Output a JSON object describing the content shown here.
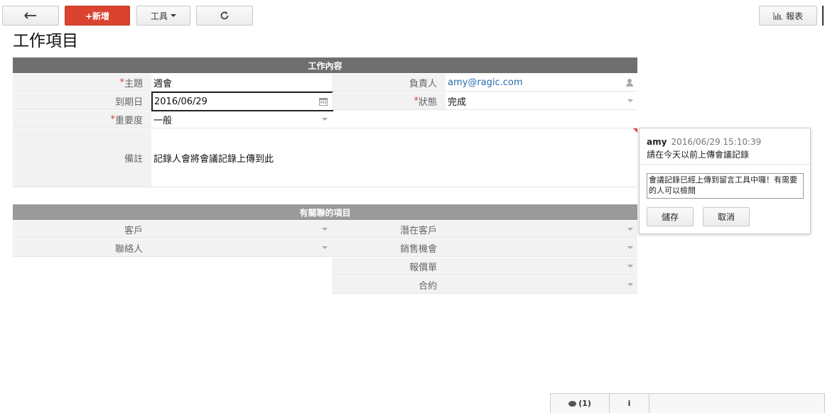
{
  "toolbar": {
    "back_icon": "arrow-left-icon",
    "new_label": "+新增",
    "tools_label": "工具",
    "refresh_icon": "refresh-icon",
    "report_label": "報表",
    "report_icon": "bar-chart-icon"
  },
  "page": {
    "title": "工作項目"
  },
  "section_main": {
    "title": "工作內容",
    "fields": {
      "subject": {
        "label": "主題",
        "required_mark": "*",
        "value": "週會"
      },
      "due_date": {
        "label": "到期日",
        "value": "2016/06/29"
      },
      "priority": {
        "label": "重要度",
        "required_mark": "*",
        "value": "一般"
      },
      "notes": {
        "label": "備註",
        "value": "記錄人會將會議記錄上傳到此"
      },
      "owner": {
        "label": "負責人",
        "value": "amy@ragic.com"
      },
      "status": {
        "label": "狀態",
        "required_mark": "*",
        "value": "完成"
      }
    }
  },
  "section_related": {
    "title": "有關聯的項目",
    "fields": {
      "customer": {
        "label": "客戶"
      },
      "contact": {
        "label": "聯絡人"
      },
      "prospect": {
        "label": "潛在客戶"
      },
      "opportunity": {
        "label": "銷售機會"
      },
      "quote": {
        "label": "報價單"
      },
      "contract": {
        "label": "合約"
      }
    }
  },
  "comment": {
    "author": "amy",
    "timestamp": "2016/06/29 15:10:39",
    "message": "請在今天以前上傳會議記錄",
    "reply_text": "會議記錄已經上傳到留言工具中囉！有需要的人可以檢閱",
    "save_label": "儲存",
    "cancel_label": "取消"
  },
  "bottom_bar": {
    "comments_label": "(1)",
    "info_label": "i"
  }
}
